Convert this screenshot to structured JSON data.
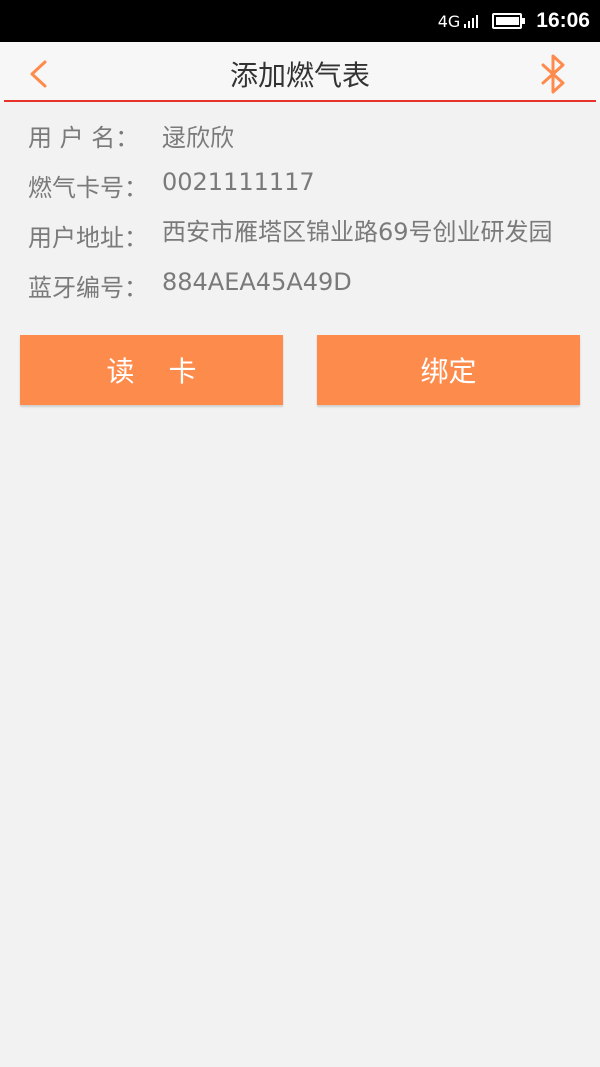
{
  "status_bar": {
    "network": "4G",
    "time": "16:06"
  },
  "header": {
    "title": "添加燃气表",
    "back_icon": "chevron-left-icon",
    "bluetooth_icon": "bluetooth-icon",
    "accent_color": "#fd8b4c",
    "divider_color": "#e8332b"
  },
  "info": {
    "username_label": "用 户 名：",
    "username": "逯欣欣",
    "card_label": "燃气卡号：",
    "card_number": "0021111117",
    "address_label": "用户地址：",
    "address": "西安市雁塔区锦业路69号创业研发园",
    "bluetooth_label": "蓝牙编号：",
    "bluetooth_id": "884AEA45A49D"
  },
  "actions": {
    "read_card": "读卡",
    "bind": "绑定"
  }
}
